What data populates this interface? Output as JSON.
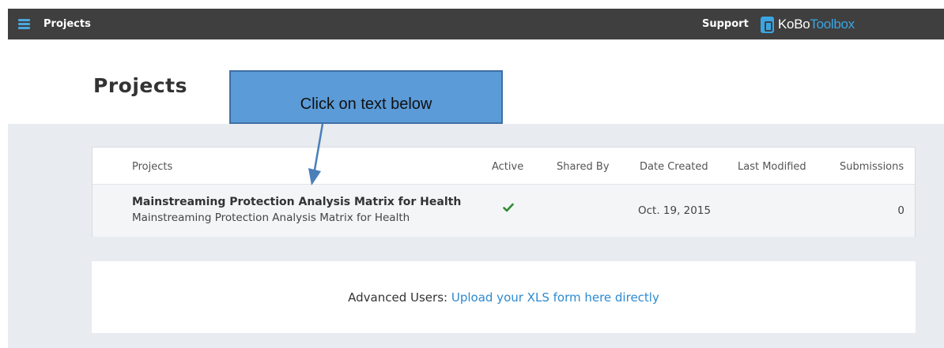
{
  "nav": {
    "title": "Projects",
    "support": "Support",
    "logo_part1": "KoBo",
    "logo_part2": "Toolbox"
  },
  "page": {
    "title": "Projects"
  },
  "callout": {
    "text": "Click on text below"
  },
  "table": {
    "headers": [
      "Projects",
      "Active",
      "Shared By",
      "Date Created",
      "Last Modified",
      "Submissions"
    ],
    "rows": [
      {
        "title": "Mainstreaming Protection Analysis Matrix for Health",
        "subtitle": "Mainstreaming Protection Analysis Matrix for Health",
        "active": true,
        "shared_by": "",
        "date_created": "Oct. 19, 2015",
        "last_modified": "",
        "submissions": "0"
      }
    ]
  },
  "advanced": {
    "label": "Advanced Users:",
    "link": "Upload your XLS form here directly"
  },
  "colors": {
    "topbar": "#3f3f3f",
    "accent": "#3aa5e3",
    "link": "#2c8ad1",
    "check": "#2e8b2e",
    "callout": "#5b9bd8"
  },
  "icons": {
    "menu": "hamburger-icon",
    "logo": "kobo-logo-icon",
    "active": "checkmark-icon"
  }
}
